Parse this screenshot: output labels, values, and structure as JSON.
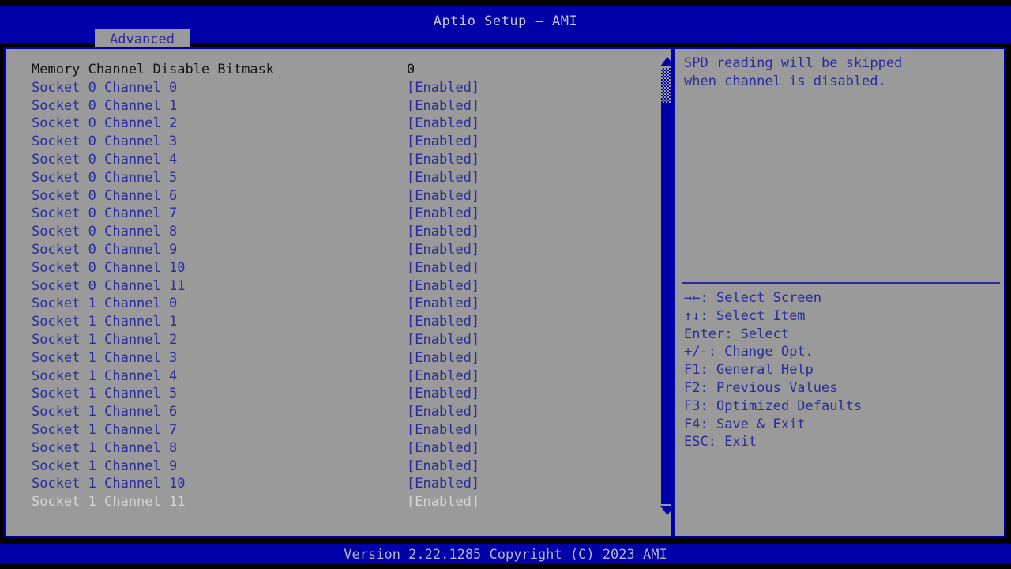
{
  "window": {
    "title": "Aptio Setup – AMI",
    "background_color": "#9a9a9a",
    "chrome_color": "#0000a8",
    "text_color": "#2b2b9c"
  },
  "menu": {
    "tabs": [
      {
        "label": "Advanced",
        "active": true
      }
    ]
  },
  "settings_list": {
    "value_column_header": "",
    "rows": [
      {
        "label": "Memory Channel Disable Bitmask",
        "value": "0",
        "style": "dark",
        "selectable": false
      },
      {
        "label": "Socket 0 Channel 0",
        "value": "[Enabled]",
        "style": "blue",
        "selectable": true
      },
      {
        "label": "Socket 0 Channel 1",
        "value": "[Enabled]",
        "style": "blue",
        "selectable": true
      },
      {
        "label": "Socket 0 Channel 2",
        "value": "[Enabled]",
        "style": "blue",
        "selectable": true
      },
      {
        "label": "Socket 0 Channel 3",
        "value": "[Enabled]",
        "style": "blue",
        "selectable": true
      },
      {
        "label": "Socket 0 Channel 4",
        "value": "[Enabled]",
        "style": "blue",
        "selectable": true
      },
      {
        "label": "Socket 0 Channel 5",
        "value": "[Enabled]",
        "style": "blue",
        "selectable": true
      },
      {
        "label": "Socket 0 Channel 6",
        "value": "[Enabled]",
        "style": "blue",
        "selectable": true
      },
      {
        "label": "Socket 0 Channel 7",
        "value": "[Enabled]",
        "style": "blue",
        "selectable": true
      },
      {
        "label": "Socket 0 Channel 8",
        "value": "[Enabled]",
        "style": "blue",
        "selectable": true
      },
      {
        "label": "Socket 0 Channel 9",
        "value": "[Enabled]",
        "style": "blue",
        "selectable": true
      },
      {
        "label": "Socket 0 Channel 10",
        "value": "[Enabled]",
        "style": "blue",
        "selectable": true
      },
      {
        "label": "Socket 0 Channel 11",
        "value": "[Enabled]",
        "style": "blue",
        "selectable": true
      },
      {
        "label": "Socket 1 Channel 0",
        "value": "[Enabled]",
        "style": "blue",
        "selectable": true
      },
      {
        "label": "Socket 1 Channel 1",
        "value": "[Enabled]",
        "style": "blue",
        "selectable": true
      },
      {
        "label": "Socket 1 Channel 2",
        "value": "[Enabled]",
        "style": "blue",
        "selectable": true
      },
      {
        "label": "Socket 1 Channel 3",
        "value": "[Enabled]",
        "style": "blue",
        "selectable": true
      },
      {
        "label": "Socket 1 Channel 4",
        "value": "[Enabled]",
        "style": "blue",
        "selectable": true
      },
      {
        "label": "Socket 1 Channel 5",
        "value": "[Enabled]",
        "style": "blue",
        "selectable": true
      },
      {
        "label": "Socket 1 Channel 6",
        "value": "[Enabled]",
        "style": "blue",
        "selectable": true
      },
      {
        "label": "Socket 1 Channel 7",
        "value": "[Enabled]",
        "style": "blue",
        "selectable": true
      },
      {
        "label": "Socket 1 Channel 8",
        "value": "[Enabled]",
        "style": "blue",
        "selectable": true
      },
      {
        "label": "Socket 1 Channel 9",
        "value": "[Enabled]",
        "style": "blue",
        "selectable": true
      },
      {
        "label": "Socket 1 Channel 10",
        "value": "[Enabled]",
        "style": "blue",
        "selectable": true
      },
      {
        "label": "Socket 1 Channel 11",
        "value": "[Enabled]",
        "style": "light",
        "selectable": true
      }
    ]
  },
  "scrollbar": {
    "up_arrow_icon": "triangle-up-icon",
    "down_arrow_icon": "triangle-down-icon",
    "thumb_top_pct": 7.9,
    "thumb_height_pct": 92.1
  },
  "help": {
    "text": "SPD reading will be skipped\nwhen channel is disabled.",
    "legend": [
      {
        "keys": "→←",
        "desc": ": Select Screen"
      },
      {
        "keys": "↑↓",
        "desc": ": Select Item"
      },
      {
        "keys": "Enter",
        "desc": ": Select"
      },
      {
        "keys": "+/-",
        "desc": ": Change Opt."
      },
      {
        "keys": "F1",
        "desc": ": General Help"
      },
      {
        "keys": "F2",
        "desc": ": Previous Values"
      },
      {
        "keys": "F3",
        "desc": ": Optimized Defaults"
      },
      {
        "keys": "F4",
        "desc": ": Save & Exit"
      },
      {
        "keys": "ESC",
        "desc": ": Exit"
      }
    ]
  },
  "footer": {
    "version_text": "Version 2.22.1285 Copyright (C) 2023 AMI"
  }
}
